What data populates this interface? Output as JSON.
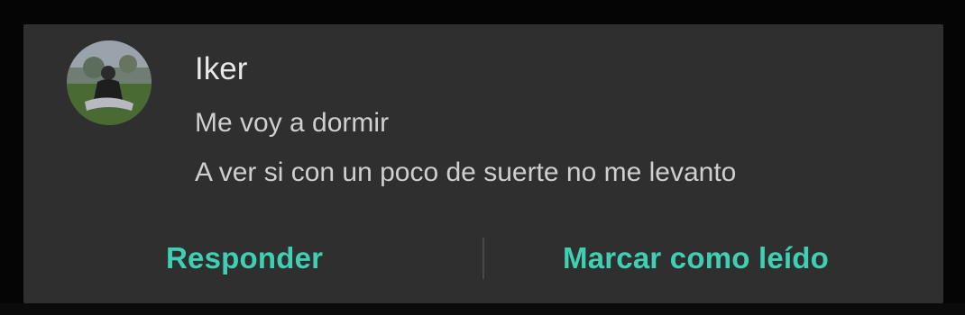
{
  "notification": {
    "sender": "Iker",
    "messages": [
      "Me voy a dormir",
      "A ver si con un poco de suerte no me levanto"
    ],
    "actions": {
      "reply": "Responder",
      "mark_read": "Marcar como leído"
    },
    "accent_color": "#3fcfb2",
    "background_color": "#2f2f2f"
  }
}
